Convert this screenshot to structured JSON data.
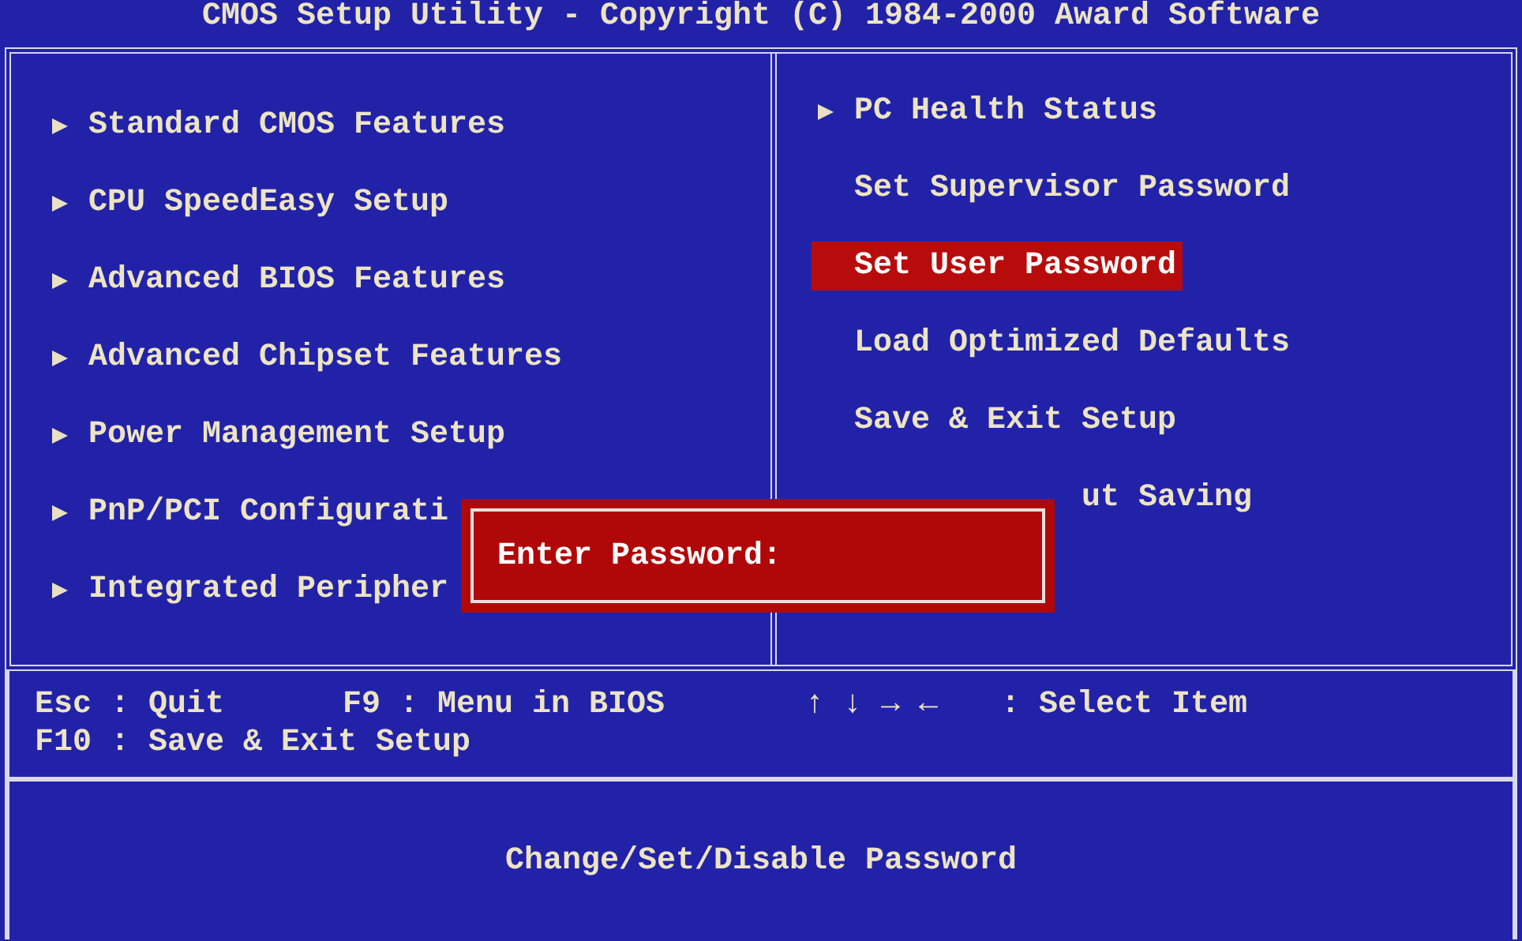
{
  "title": "CMOS Setup Utility - Copyright (C) 1984-2000 Award Software",
  "left_menu": [
    {
      "label": "Standard CMOS Features",
      "submenu": true
    },
    {
      "label": "CPU SpeedEasy Setup",
      "submenu": true
    },
    {
      "label": "Advanced BIOS Features",
      "submenu": true
    },
    {
      "label": "Advanced Chipset Features",
      "submenu": true
    },
    {
      "label": "Power Management Setup",
      "submenu": true
    },
    {
      "label": "PnP/PCI Configurati",
      "submenu": true
    },
    {
      "label": "Integrated Peripher",
      "submenu": true
    }
  ],
  "right_menu": [
    {
      "label": "PC Health Status",
      "submenu": true,
      "selected": false,
      "kind": "full"
    },
    {
      "label": "Set Supervisor Password",
      "submenu": false,
      "selected": false,
      "kind": "full"
    },
    {
      "label": "Set User Password",
      "submenu": false,
      "selected": true,
      "kind": "full"
    },
    {
      "label": "Load Optimized Defaults",
      "submenu": false,
      "selected": false,
      "kind": "full"
    },
    {
      "label": "Save & Exit Setup",
      "submenu": false,
      "selected": false,
      "kind": "full"
    },
    {
      "label": "ut Saving",
      "submenu": false,
      "selected": false,
      "kind": "tail"
    }
  ],
  "password_dialog": {
    "label": "Enter Password:"
  },
  "help_rows": [
    [
      "Esc : Quit",
      "F9 : Menu in BIOS",
      "↑ ↓ → ←",
      ": Select Item"
    ],
    [
      "F10 : Save & Exit Setup"
    ]
  ],
  "description": "Change/Set/Disable Password"
}
